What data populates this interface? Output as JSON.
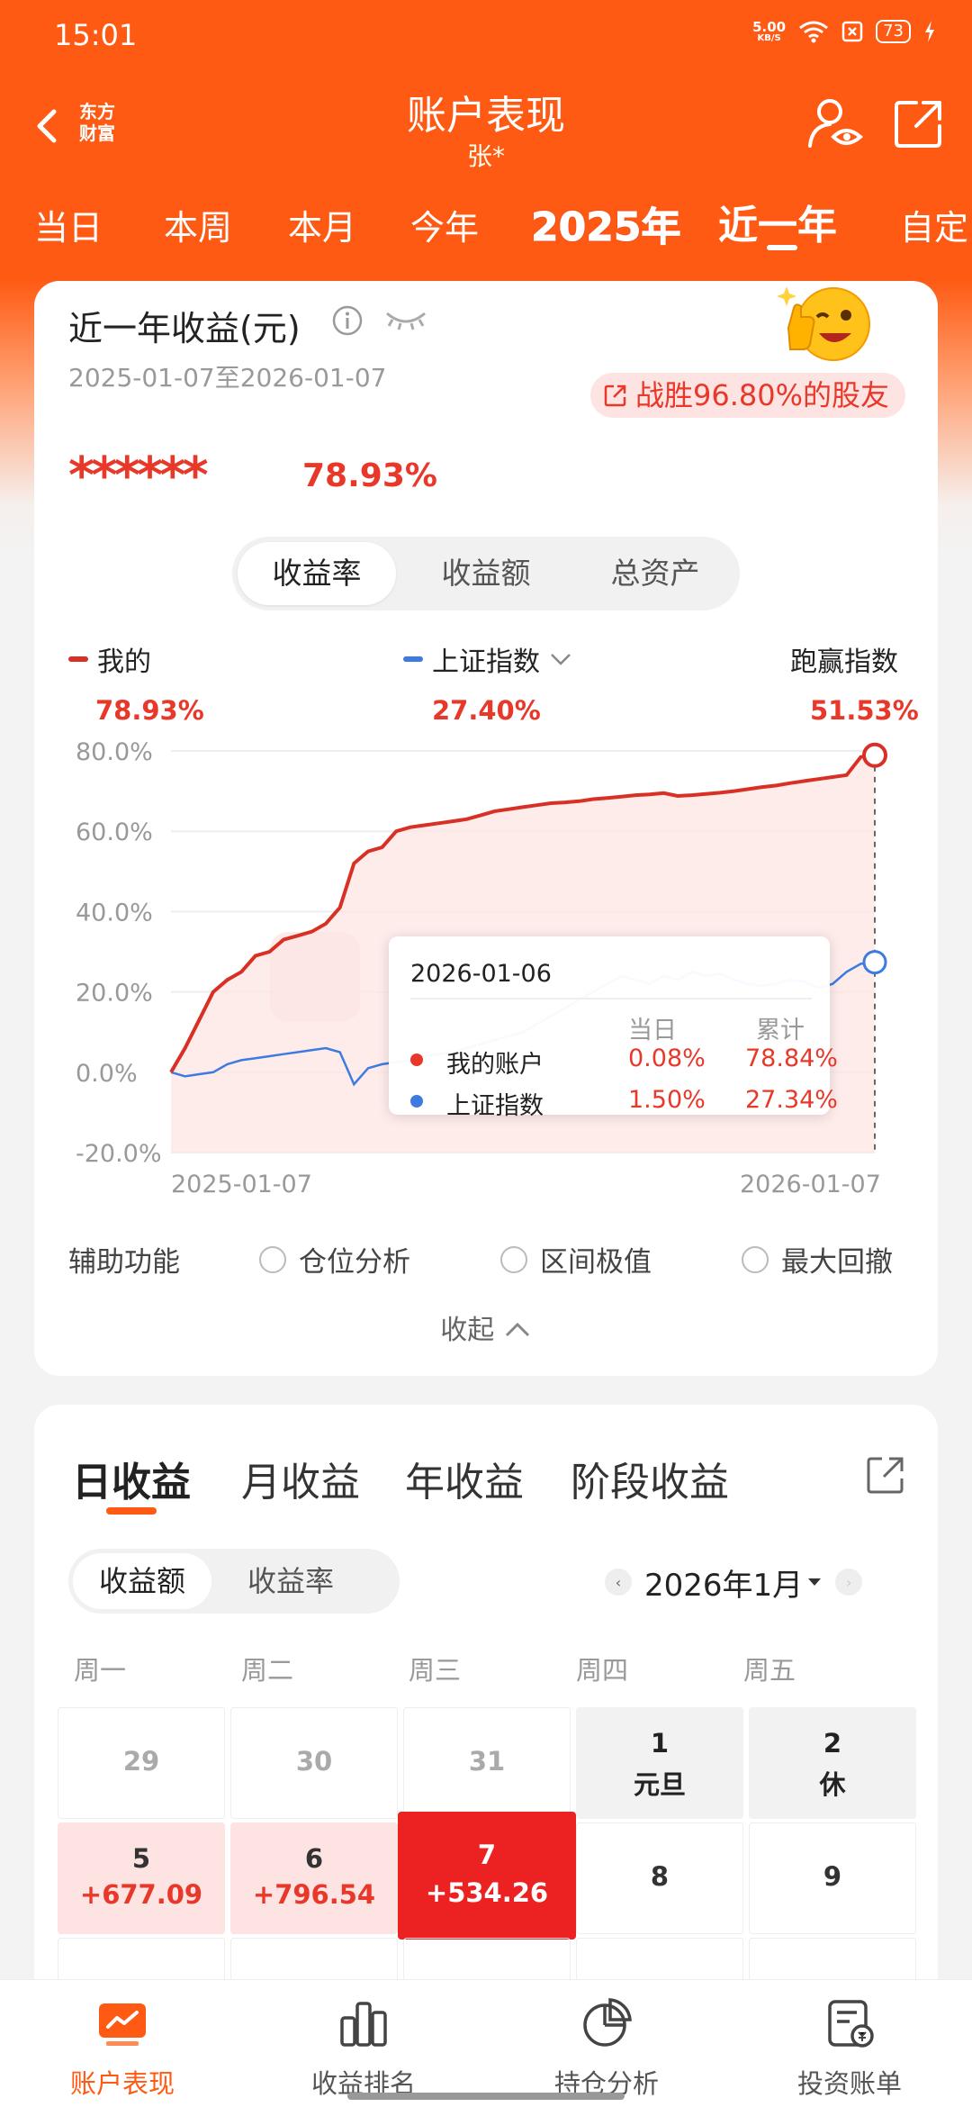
{
  "status_bar": {
    "time": "15:01",
    "net_speed": "5.00",
    "net_unit": "KB/S",
    "battery": "73"
  },
  "nav": {
    "logo_line1": "东方",
    "logo_line2": "财富",
    "title": "账户表现",
    "subtitle": "张*"
  },
  "period_tabs": [
    "当日",
    "本周",
    "本月",
    "今年",
    "2025年",
    "近一年",
    "自定"
  ],
  "active_period": "近一年",
  "summary": {
    "title": "近一年收益(元)",
    "date_range": "2025-01-07至2026-01-07",
    "beat_text": "战胜96.80%的股友",
    "masked_amount": "******",
    "return_rate": "78.93%"
  },
  "metric_tabs": [
    "收益率",
    "收益额",
    "总资产"
  ],
  "legend": {
    "mine_label": "我的",
    "mine_value": "78.93%",
    "index_label": "上证指数",
    "index_value": "27.40%",
    "beat_label": "跑赢指数",
    "beat_value": "51.53%"
  },
  "chart_data": {
    "type": "line",
    "y_ticks": [
      "80.0%",
      "60.0%",
      "40.0%",
      "20.0%",
      "0.0%",
      "-20.0%"
    ],
    "ylim": [
      -20,
      80
    ],
    "x_ticks": [
      "2025-01-07",
      "2026-01-07"
    ],
    "series": [
      {
        "name": "我的",
        "color": "#d93025",
        "values": [
          0,
          6,
          13,
          20,
          23,
          25,
          29,
          30,
          33,
          34,
          35,
          37,
          41,
          52,
          55,
          56,
          60,
          61,
          61.5,
          62,
          62.5,
          63,
          64,
          65,
          65.5,
          66,
          66.5,
          67,
          67.2,
          67.5,
          68,
          68.3,
          68.6,
          69,
          69.2,
          69.5,
          68.8,
          69,
          69.3,
          69.6,
          70,
          70.5,
          71,
          71.4,
          72,
          72.5,
          73,
          73.5,
          74,
          78.5,
          78.93
        ]
      },
      {
        "name": "上证指数",
        "color": "#3d7be0",
        "values": [
          0,
          -1,
          -0.5,
          0,
          2,
          3,
          3.5,
          4,
          4.5,
          5,
          5.5,
          6,
          5,
          -3,
          1,
          2,
          2.5,
          3,
          4,
          4.5,
          5,
          6,
          7,
          8,
          9,
          10,
          12,
          14,
          16,
          18,
          20,
          22,
          24,
          23,
          22,
          24,
          23,
          25,
          24,
          24.5,
          23,
          22,
          21.5,
          22,
          23,
          22.5,
          21,
          22,
          25,
          27,
          27.4
        ]
      }
    ]
  },
  "tooltip": {
    "date": "2026-01-06",
    "col_day": "当日",
    "col_total": "累计",
    "rows": [
      {
        "name": "我的账户",
        "day": "0.08%",
        "total": "78.84%",
        "color": "#e8382a"
      },
      {
        "name": "上证指数",
        "day": "1.50%",
        "total": "27.34%",
        "color": "#3d7be0"
      }
    ]
  },
  "aux": {
    "label": "辅助功能",
    "options": [
      "仓位分析",
      "区间极值",
      "最大回撤"
    ]
  },
  "collapse_label": "收起",
  "profit_tabs": [
    "日收益",
    "月收益",
    "年收益",
    "阶段收益"
  ],
  "calendar": {
    "modes": [
      "收益额",
      "收益率"
    ],
    "month": "2026年1月",
    "weekdays": [
      "周一",
      "周二",
      "周三",
      "周四",
      "周五"
    ],
    "row1": [
      {
        "day": "29",
        "sub": ""
      },
      {
        "day": "30",
        "sub": ""
      },
      {
        "day": "31",
        "sub": ""
      },
      {
        "day": "1",
        "sub": "元旦"
      },
      {
        "day": "2",
        "sub": "休"
      }
    ],
    "row2": [
      {
        "day": "5",
        "sub": "+677.09"
      },
      {
        "day": "6",
        "sub": "+796.54"
      },
      {
        "day": "7",
        "sub": "+534.26"
      },
      {
        "day": "8",
        "sub": ""
      },
      {
        "day": "9",
        "sub": ""
      }
    ]
  },
  "bottom_nav": [
    "账户表现",
    "收益排名",
    "持仓分析",
    "投资账单"
  ]
}
